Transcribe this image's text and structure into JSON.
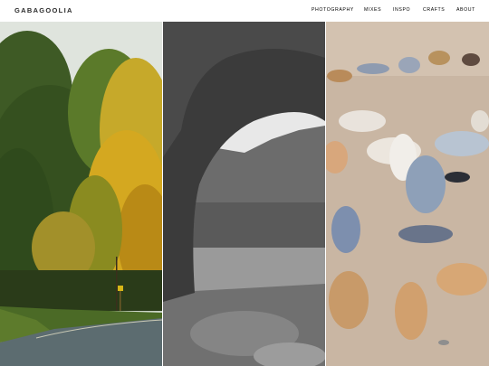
{
  "site": {
    "logo": "GABAGOOLIA"
  },
  "nav": {
    "items": [
      {
        "label": "PHOTOGRAPHY",
        "active": true
      },
      {
        "label": "MIXES"
      },
      {
        "label": "INSPO"
      },
      {
        "label": "CRAFTS"
      },
      {
        "label": "ABOUT"
      }
    ]
  },
  "gallery": {
    "tiles": [
      {
        "icon": "photo-autumn-road"
      },
      {
        "icon": "photo-rock-arch-bw"
      },
      {
        "icon": "photo-bird-decoys-sand"
      }
    ]
  }
}
